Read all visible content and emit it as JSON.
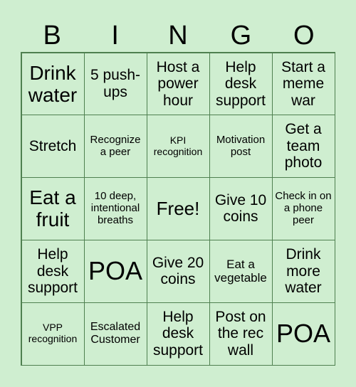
{
  "header": [
    "B",
    "I",
    "N",
    "G",
    "O"
  ],
  "colors": {
    "background": "#cfeed0",
    "grid_line": "#4f8050"
  },
  "cells": [
    "Drink water",
    "5 push-ups",
    "Host a power hour",
    "Help desk support",
    "Start a meme war",
    "Stretch",
    "Recognize a peer",
    "KPI recognition",
    "Motivation post",
    "Get a team photo",
    "Eat a fruit",
    "10 deep, intentional breaths",
    "Free!",
    "Give 10 coins",
    "Check in on a phone peer",
    "Help desk support",
    "POA",
    "Give 20 coins",
    "Eat a vegetable",
    "Drink more water",
    "VPP recognition",
    "Escalated Customer",
    "Help desk support",
    "Post on the rec wall",
    "POA"
  ]
}
